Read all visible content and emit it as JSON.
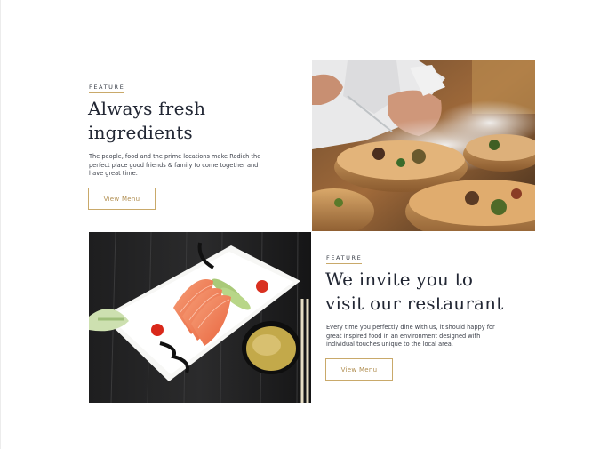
{
  "section_one": {
    "eyebrow": "FEATURE",
    "heading_line1": "Always fresh",
    "heading_line2": "ingredients",
    "body_line1": "The people, food and the prime locations make Rodich the",
    "body_line2": "perfect place good friends & family to come together and",
    "body_line3": "have great time.",
    "button_label": "View Menu",
    "image_icon": "chef-plating-dish-photo"
  },
  "section_two": {
    "eyebrow": "FEATURE",
    "heading_line1": "We invite you to",
    "heading_line2": "visit our restaurant",
    "body_line1": "Every time you perfectly dine with us, it should happy for",
    "body_line2": "great inspired food in an environment designed with",
    "body_line3": "individual touches unique to the local area.",
    "button_label": "View Menu",
    "image_icon": "salmon-sashimi-plate-photo"
  },
  "colors": {
    "accent": "#c9a96a",
    "heading": "#222734",
    "text": "#3c404a",
    "background": "#ffffff"
  }
}
